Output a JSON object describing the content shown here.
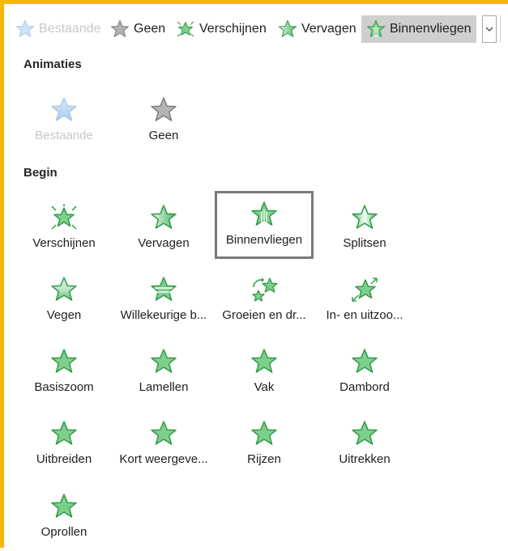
{
  "toolbar": {
    "items": [
      {
        "label": "Bestaande",
        "icon": "star-blue-icon",
        "state": "disabled"
      },
      {
        "label": "Geen",
        "icon": "star-gray-icon",
        "state": "normal"
      },
      {
        "label": "Verschijnen",
        "icon": "star-burst-icon",
        "state": "normal"
      },
      {
        "label": "Vervagen",
        "icon": "star-fade-icon",
        "state": "normal"
      },
      {
        "label": "Binnenvliegen",
        "icon": "star-fly-in-icon",
        "state": "selected"
      }
    ],
    "dropdown_icon": "chevron-down-icon"
  },
  "sections": {
    "animaties": "Animaties",
    "begin": "Begin"
  },
  "animaties_items": [
    {
      "label": "Bestaande",
      "icon": "star-blue-icon",
      "state": "disabled"
    },
    {
      "label": "Geen",
      "icon": "star-gray-icon",
      "state": "normal"
    }
  ],
  "begin_items": [
    {
      "label": "Verschijnen",
      "icon": "star-burst-icon"
    },
    {
      "label": "Vervagen",
      "icon": "star-fade-icon"
    },
    {
      "label": "Binnenvliegen",
      "icon": "star-fly-in-icon",
      "state": "selected"
    },
    {
      "label": "Splitsen",
      "icon": "star-split-icon"
    },
    {
      "label": "Vegen",
      "icon": "star-wipe-icon"
    },
    {
      "label": "Willekeurige b...",
      "icon": "star-bars-icon"
    },
    {
      "label": "Groeien en dr...",
      "icon": "star-grow-turn-icon"
    },
    {
      "label": "In- en uitzoo...",
      "icon": "star-zoom-icon"
    },
    {
      "label": "Basiszoom",
      "icon": "star-icon"
    },
    {
      "label": "Lamellen",
      "icon": "star-icon"
    },
    {
      "label": "Vak",
      "icon": "star-icon"
    },
    {
      "label": "Dambord",
      "icon": "star-icon"
    },
    {
      "label": "Uitbreiden",
      "icon": "star-icon"
    },
    {
      "label": "Kort weergeve...",
      "icon": "star-icon"
    },
    {
      "label": "Rijzen",
      "icon": "star-icon"
    },
    {
      "label": "Uitrekken",
      "icon": "star-icon"
    },
    {
      "label": "Oprollen",
      "icon": "star-icon"
    }
  ],
  "colors": {
    "accent_border": "#f6b70a",
    "star_green": "#7fcf8c",
    "star_green_stroke": "#2f9a48",
    "star_gray": "#b4b4b4",
    "star_blue": "#b7d6f2",
    "selected_bg": "#cfcfcf",
    "selected_border": "#7a7a7a"
  }
}
